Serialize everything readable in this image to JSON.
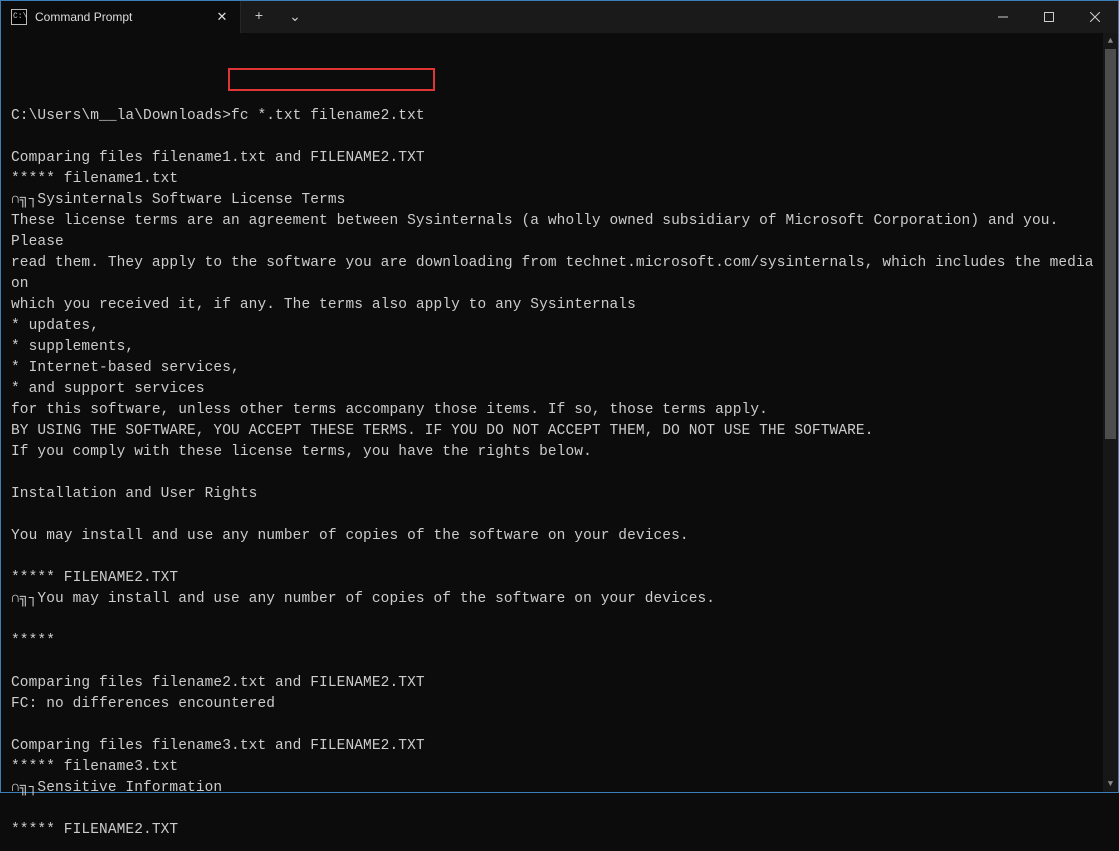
{
  "titlebar": {
    "icon_text": "C:\\",
    "tab_title": "Command Prompt",
    "close_glyph": "✕",
    "plus_glyph": "+",
    "chevron_glyph": "⌄"
  },
  "terminal": {
    "prompt_path": "C:\\Users\\m__la\\Downloads>",
    "command": "fc *.txt filename2.txt",
    "lines": [
      "",
      "Comparing files filename1.txt and FILENAME2.TXT",
      "***** filename1.txt",
      "∩╗┐Sysinternals Software License Terms",
      "These license terms are an agreement between Sysinternals (a wholly owned subsidiary of Microsoft Corporation) and you. Please",
      "read them. They apply to the software you are downloading from technet.microsoft.com/sysinternals, which includes the media on",
      "which you received it, if any. The terms also apply to any Sysinternals",
      "* updates,",
      "* supplements,",
      "* Internet-based services,",
      "* and support services",
      "for this software, unless other terms accompany those items. If so, those terms apply.",
      "BY USING THE SOFTWARE, YOU ACCEPT THESE TERMS. IF YOU DO NOT ACCEPT THEM, DO NOT USE THE SOFTWARE.",
      "If you comply with these license terms, you have the rights below.",
      "",
      "Installation and User Rights",
      "",
      "You may install and use any number of copies of the software on your devices.",
      "",
      "***** FILENAME2.TXT",
      "∩╗┐You may install and use any number of copies of the software on your devices.",
      "",
      "*****",
      "",
      "Comparing files filename2.txt and FILENAME2.TXT",
      "FC: no differences encountered",
      "",
      "Comparing files filename3.txt and FILENAME2.TXT",
      "***** filename3.txt",
      "∩╗┐Sensitive Information",
      "",
      "***** FILENAME2.TXT"
    ]
  }
}
